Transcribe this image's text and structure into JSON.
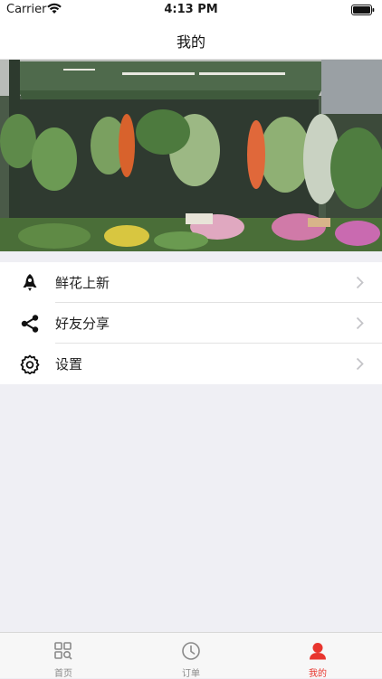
{
  "status_bar": {
    "carrier": "Carrier",
    "time": "4:13 PM"
  },
  "nav": {
    "title": "我的"
  },
  "banner": {
    "description_icon": "flower-shop-photo"
  },
  "menu": {
    "items": [
      {
        "label": "鲜花上新",
        "icon": "rocket-icon"
      },
      {
        "label": "好友分享",
        "icon": "share-icon"
      },
      {
        "label": "设置",
        "icon": "gear-icon"
      }
    ]
  },
  "tab_bar": {
    "tabs": [
      {
        "label": "首页",
        "icon": "home-grid-icon",
        "active": false
      },
      {
        "label": "订单",
        "icon": "clock-icon",
        "active": false
      },
      {
        "label": "我的",
        "icon": "user-icon",
        "active": true
      }
    ],
    "active_color": "#e8352e",
    "inactive_color": "#8a8a8a"
  }
}
